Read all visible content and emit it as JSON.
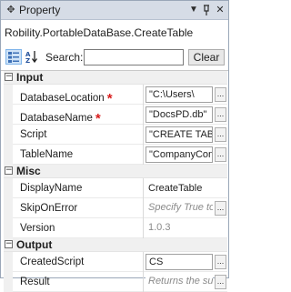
{
  "panel": {
    "title": "Property",
    "object_name": "Robility.PortableDataBase.CreateTable"
  },
  "toolbar": {
    "search_label": "Search:",
    "search_value": "",
    "clear_label": "Clear"
  },
  "icons": {
    "title": "pin-icon",
    "categorized": "categorized-view-icon",
    "alphabetical": "alphabetical-sort-icon",
    "dropdown": "chevron-down-icon",
    "autohide": "pin-icon",
    "close": "close-icon",
    "collapse": "minus-icon",
    "ellipsis": "ellipsis-icon"
  },
  "colors": {
    "required": "#d81e1e",
    "titlebar": "#d6dce6",
    "selected_toolbar": "#cfe3f7"
  },
  "sections": [
    {
      "label": "Input",
      "collapse_glyph": "−",
      "rows": [
        {
          "name": "DatabaseLocation",
          "required_mark": "*",
          "value": "\"C:\\Users\\",
          "style": "boxed",
          "ellipsis": "..."
        },
        {
          "name": "DatabaseName",
          "required_mark": "*",
          "value": "\"DocsPD.db\"",
          "style": "boxed",
          "ellipsis": "..."
        },
        {
          "name": "Script",
          "required_mark": "",
          "value": "\"CREATE TABLE",
          "style": "boxed",
          "ellipsis": "..."
        },
        {
          "name": "TableName",
          "required_mark": "",
          "value": "\"CompanyCont",
          "style": "boxed",
          "ellipsis": "..."
        }
      ]
    },
    {
      "label": "Misc",
      "collapse_glyph": "−",
      "rows": [
        {
          "name": "DisplayName",
          "required_mark": "",
          "value": "CreateTable",
          "style": "plain",
          "ellipsis": ""
        },
        {
          "name": "SkipOnError",
          "required_mark": "",
          "value": "Specify True to",
          "style": "hint",
          "ellipsis": "..."
        },
        {
          "name": "Version",
          "required_mark": "",
          "value": "1.0.3",
          "style": "gray",
          "ellipsis": ""
        }
      ]
    },
    {
      "label": "Output",
      "collapse_glyph": "−",
      "rows": [
        {
          "name": "CreatedScript",
          "required_mark": "",
          "value": "CS",
          "style": "boxed",
          "ellipsis": "..."
        },
        {
          "name": "Result",
          "required_mark": "",
          "value": "Returns the suc",
          "style": "hint",
          "ellipsis": "..."
        }
      ]
    }
  ]
}
